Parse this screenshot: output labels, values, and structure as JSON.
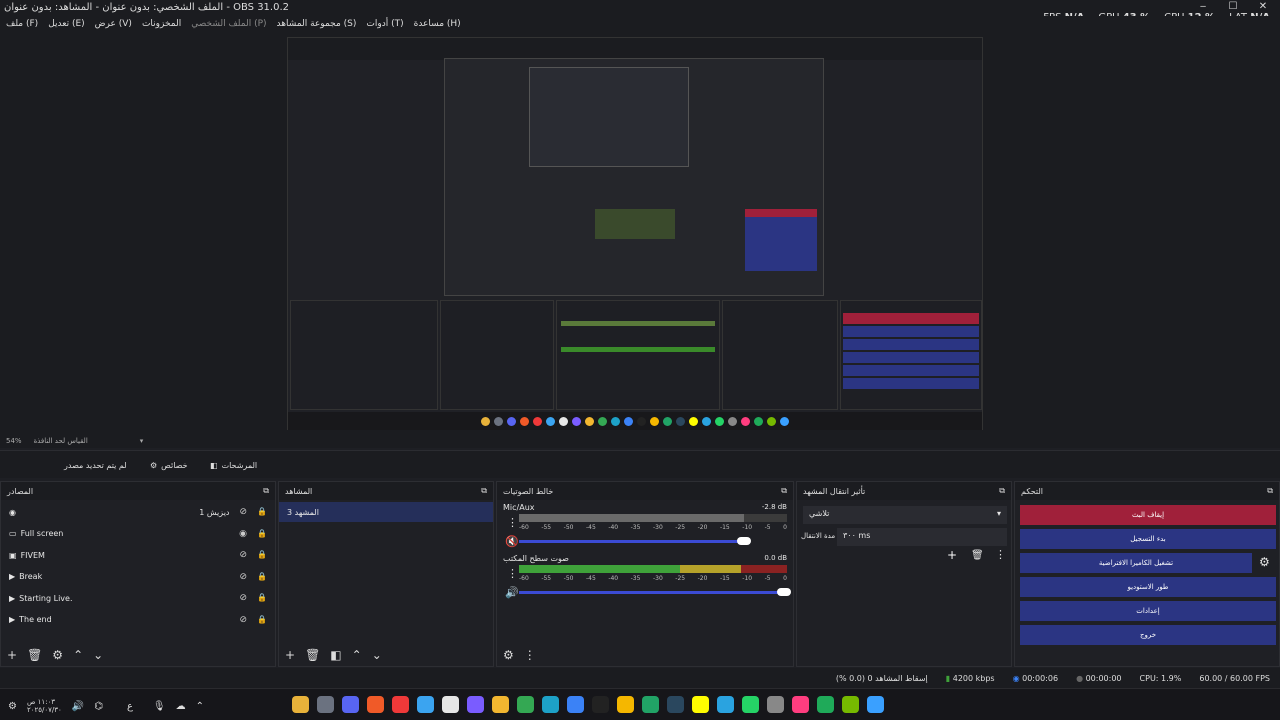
{
  "window": {
    "title": "الملف الشخصي: بدون عنوان - المشاهد: بدون عنوان - OBS 31.0.2",
    "minimize": "‒",
    "maximize": "☐",
    "close": "✕"
  },
  "stats": {
    "fps_label": "FPS",
    "fps_value": "N/A",
    "gpu_label": "GPU",
    "gpu_value": "43 %",
    "cpu_label": "CPU",
    "cpu_value": "12 %",
    "lat_label": "LAT",
    "lat_value": "N/A"
  },
  "menu": [
    "ملف (F)",
    "تعديل (E)",
    "عرض (V)",
    "المخزونات",
    "الملف الشخصي (P)",
    "مجموعة المشاهد (S)",
    "أدوات (T)",
    "مساعدة (H)"
  ],
  "zoom": {
    "value": "54%",
    "label": "القياس لحد النافذة"
  },
  "tabs": {
    "no_source": "لم يتم تحديد مصدر",
    "properties": "خصائص",
    "filters": "المرشحات"
  },
  "docks": {
    "sources_title": "المصادر",
    "scenes_title": "المشاهد",
    "mixer_title": "خالط الصوتيات",
    "transitions_title": "تأثير انتقال المشهد",
    "controls_title": "التحكم"
  },
  "sources": [
    {
      "name": "ديزيش 1",
      "icon": "record-icon"
    },
    {
      "name": "Full screen",
      "icon": "monitor-icon"
    },
    {
      "name": "FIVEM",
      "icon": "window-icon"
    },
    {
      "name": "Break",
      "icon": "play-icon"
    },
    {
      "name": "Starting Live.",
      "icon": "play-icon"
    },
    {
      "name": "The end",
      "icon": "play-icon"
    }
  ],
  "scenes": [
    "المشهد 3"
  ],
  "mixer": [
    {
      "name": "Mic/Aux",
      "db": "-2.8 dB",
      "muted": true
    },
    {
      "name": "صوت سطح المكتب",
      "db": "0.0 dB",
      "muted": false
    }
  ],
  "mixer_ticks": [
    "-60",
    "-55",
    "-50",
    "-45",
    "-40",
    "-35",
    "-30",
    "-25",
    "-20",
    "-15",
    "-10",
    "-5",
    "0"
  ],
  "transitions": {
    "type": "تلاشي",
    "duration_label": "مدة الانتقال",
    "duration_value": "٣٠٠ ms"
  },
  "controls": [
    {
      "label": "إيقاف البث",
      "color": "#a0203a"
    },
    {
      "label": "بدء التسجيل",
      "color": "#2b3583"
    },
    {
      "label": "تشغيل الكاميرا الافتراضية",
      "color": "#2b3583"
    },
    {
      "label": "طور الاستوديو",
      "color": "#2b3583"
    },
    {
      "label": "إعدادات",
      "color": "#2b3583"
    },
    {
      "label": "خروج",
      "color": "#2b3583"
    }
  ],
  "status": {
    "dropped": "إسقاط المشاهد 0 (0.0 %)",
    "kbps": "4200 kbps",
    "stream_time": "00:00:06",
    "rec_time": "00:00:00",
    "cpu": "CPU: 1.9%",
    "fps": "60.00 / 60.00 FPS"
  },
  "clock": {
    "time": "١١:٠٣ ص",
    "date": "٢٠٢٥/٠٧/٣٠"
  },
  "taskbar_icons": [
    {
      "name": "chrome-icon",
      "color": "#e8b23a"
    },
    {
      "name": "settings-icon",
      "color": "#6b7280"
    },
    {
      "name": "discord-icon",
      "color": "#5865f2"
    },
    {
      "name": "brave-icon",
      "color": "#f05a28"
    },
    {
      "name": "vivaldi-icon",
      "color": "#ef3939"
    },
    {
      "name": "files-icon",
      "color": "#3ba4f0"
    },
    {
      "name": "notepad-icon",
      "color": "#e6e6e6"
    },
    {
      "name": "obs-icon",
      "color": "#7a5cff"
    },
    {
      "name": "arc-icon",
      "color": "#f2b630"
    },
    {
      "name": "chrome2-icon",
      "color": "#34a853"
    },
    {
      "name": "edge-icon",
      "color": "#1da1c7"
    },
    {
      "name": "app-icon",
      "color": "#3b82f6"
    },
    {
      "name": "epic-icon",
      "color": "#222"
    },
    {
      "name": "rockstar-icon",
      "color": "#f5b700"
    },
    {
      "name": "xbox-icon",
      "color": "#21a366"
    },
    {
      "name": "steam-icon",
      "color": "#2a475e"
    },
    {
      "name": "snap-icon",
      "color": "#fffc00"
    },
    {
      "name": "telegram-icon",
      "color": "#2aa3e0"
    },
    {
      "name": "whatsapp-icon",
      "color": "#25d366"
    },
    {
      "name": "clock-icon",
      "color": "#888"
    },
    {
      "name": "capcut-icon",
      "color": "#ff3d7f"
    },
    {
      "name": "b-icon",
      "color": "#1faa59"
    },
    {
      "name": "nvidia-icon",
      "color": "#76b900"
    },
    {
      "name": "windows-icon",
      "color": "#3aa0ff"
    }
  ]
}
